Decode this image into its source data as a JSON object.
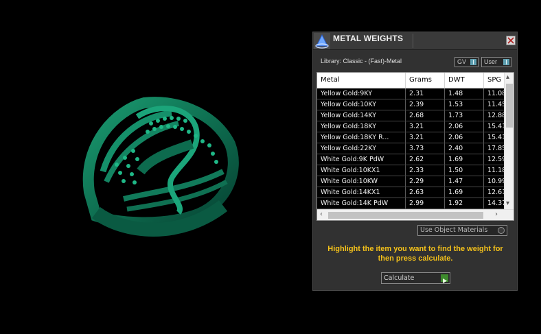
{
  "dialog": {
    "title": "METAL WEIGHTS",
    "library_label": "Library: Classic - (Fast)-Metal",
    "toggle_gv": "GV",
    "toggle_user": "User",
    "use_object_materials": "Use Object Materials",
    "hint": "Highlight the item you want to find the weight for then press calculate.",
    "calculate_label": "Calculate"
  },
  "table": {
    "columns": [
      "Metal",
      "Grams",
      "DWT",
      "SPG"
    ],
    "rows": [
      {
        "metal": "Yellow Gold:9KY",
        "grams": "2.31",
        "dwt": "1.48",
        "spg": "11.08"
      },
      {
        "metal": "Yellow Gold:10KY",
        "grams": "2.39",
        "dwt": "1.53",
        "spg": "11.45"
      },
      {
        "metal": "Yellow Gold:14KY",
        "grams": "2.68",
        "dwt": "1.73",
        "spg": "12.88"
      },
      {
        "metal": "Yellow Gold:18KY",
        "grams": "3.21",
        "dwt": "2.06",
        "spg": "15.41"
      },
      {
        "metal": "Yellow Gold:18KY R...",
        "grams": "3.21",
        "dwt": "2.06",
        "spg": "15.41"
      },
      {
        "metal": "Yellow Gold:22KY",
        "grams": "3.73",
        "dwt": "2.40",
        "spg": "17.85"
      },
      {
        "metal": "White Gold:9K PdW",
        "grams": "2.62",
        "dwt": "1.69",
        "spg": "12.59"
      },
      {
        "metal": "White Gold:10KX1",
        "grams": "2.33",
        "dwt": "1.50",
        "spg": "11.18"
      },
      {
        "metal": "White Gold:10KW",
        "grams": "2.29",
        "dwt": "1.47",
        "spg": "10.99"
      },
      {
        "metal": "White Gold:14KX1",
        "grams": "2.63",
        "dwt": "1.69",
        "spg": "12.61"
      },
      {
        "metal": "White Gold:14K PdW",
        "grams": "2.99",
        "dwt": "1.92",
        "spg": "14.37"
      }
    ]
  },
  "colors": {
    "ring": "#0f7a5a",
    "hint": "#f5c21a",
    "panel": "#313131"
  }
}
